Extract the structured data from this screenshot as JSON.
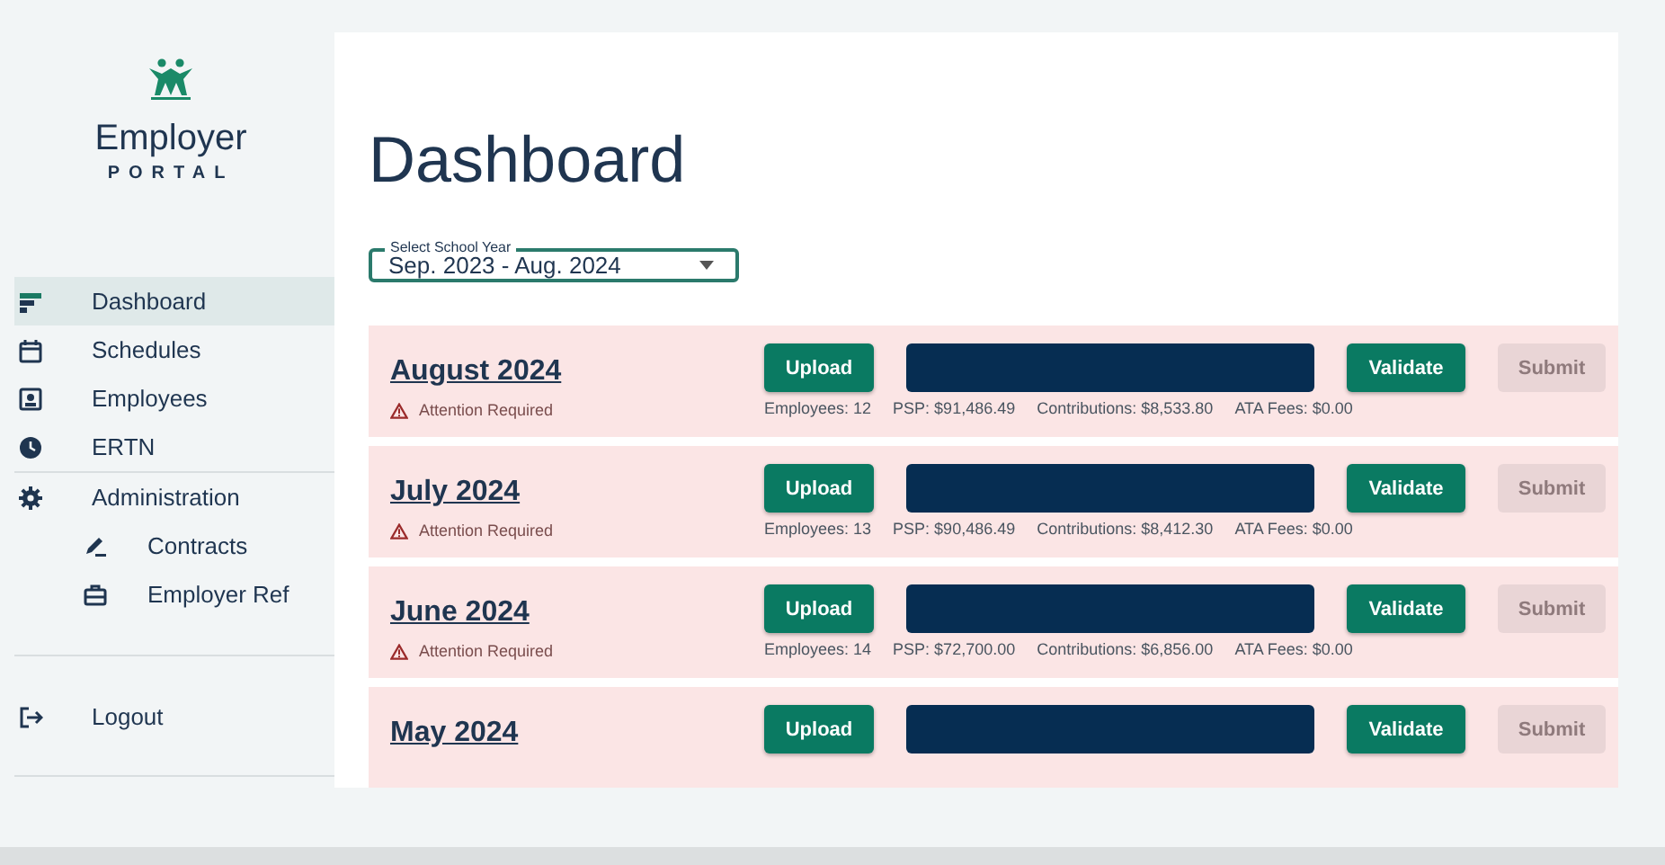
{
  "logo": {
    "title": "Employer",
    "subtitle": "PORTAL"
  },
  "sidebar": {
    "items": [
      {
        "label": "Dashboard",
        "kind": "dashboard",
        "selected": true
      },
      {
        "label": "Schedules",
        "kind": "calendar",
        "selected": false
      },
      {
        "label": "Employees",
        "kind": "badge",
        "selected": false
      },
      {
        "label": "ERTN",
        "kind": "clock",
        "selected": false
      },
      {
        "label": "Administration",
        "kind": "gear",
        "selected": false,
        "children": [
          {
            "label": "Contracts",
            "kind": "pen",
            "selected": false
          },
          {
            "label": "Employer Ref",
            "kind": "briefcase",
            "selected": false
          }
        ]
      }
    ],
    "logout": {
      "label": "Logout"
    }
  },
  "page_title": "Dashboard",
  "school_year": {
    "label": "Select School Year",
    "value": "Sep. 2023 - Aug. 2024"
  },
  "months": [
    {
      "title": "August 2024",
      "alert": "Attention Required",
      "upload": "Upload",
      "validate": "Validate",
      "submit": "Submit",
      "submit_disabled": true,
      "stats": [
        "Employees: 12",
        "PSP: $91,486.49",
        "Contributions: $8,533.80",
        "ATA Fees: $0.00"
      ]
    },
    {
      "title": "July 2024",
      "alert": "Attention Required",
      "upload": "Upload",
      "validate": "Validate",
      "submit": "Submit",
      "submit_disabled": true,
      "stats": [
        "Employees: 13",
        "PSP: $90,486.49",
        "Contributions: $8,412.30",
        "ATA Fees: $0.00"
      ]
    },
    {
      "title": "June 2024",
      "alert": "Attention Required",
      "upload": "Upload",
      "validate": "Validate",
      "submit": "Submit",
      "submit_disabled": true,
      "stats": [
        "Employees: 14",
        "PSP: $72,700.00",
        "Contributions: $6,856.00",
        "ATA Fees: $0.00"
      ]
    },
    {
      "title": "May 2024",
      "upload": "Upload",
      "validate": "Validate",
      "submit": "Submit",
      "submit_disabled": true
    }
  ]
}
